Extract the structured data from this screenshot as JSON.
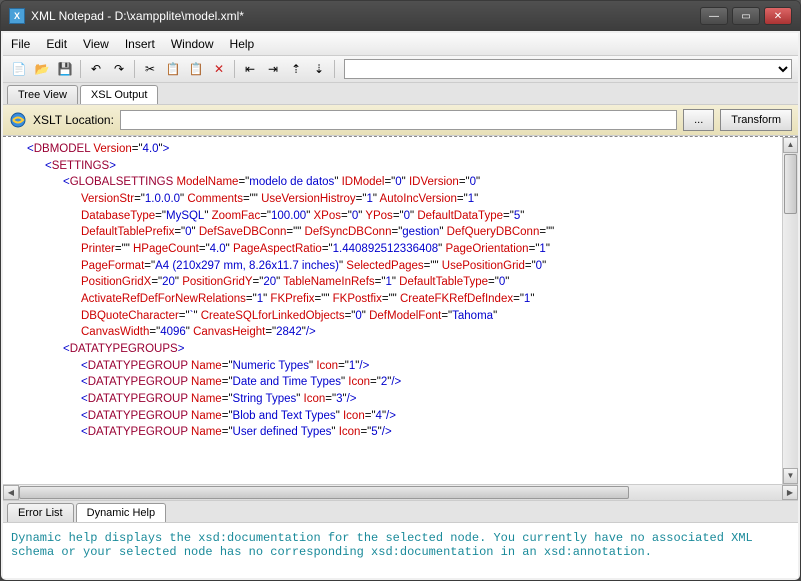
{
  "window": {
    "title": "XML Notepad - D:\\xampplite\\model.xml*"
  },
  "menu": {
    "file": "File",
    "edit": "Edit",
    "view": "View",
    "insert": "Insert",
    "window": "Window",
    "help": "Help"
  },
  "tabs": {
    "tree": "Tree View",
    "xsl": "XSL Output"
  },
  "xslt": {
    "label": "XSLT Location:",
    "browse": "...",
    "transform": "Transform"
  },
  "bottom_tabs": {
    "error": "Error List",
    "help": "Dynamic Help"
  },
  "help_text": "Dynamic help displays the xsd:documentation for the selected node. You currently have no associated XML schema or your selected node has no corresponding xsd:documentation in an xsd:annotation.",
  "xml": {
    "root": "DBMODEL",
    "root_attrs": [
      [
        "Version",
        "4.0"
      ]
    ],
    "settings": "SETTINGS",
    "global": "GLOBALSETTINGS",
    "global_attrs_lines": [
      [
        [
          "ModelName",
          "modelo de datos"
        ],
        [
          "IDModel",
          "0"
        ],
        [
          "IDVersion",
          "0"
        ]
      ],
      [
        [
          "VersionStr",
          "1.0.0.0"
        ],
        [
          "Comments",
          ""
        ],
        [
          "UseVersionHistroy",
          "1"
        ],
        [
          "AutoIncVersion",
          "1"
        ]
      ],
      [
        [
          "DatabaseType",
          "MySQL"
        ],
        [
          "ZoomFac",
          "100.00"
        ],
        [
          "XPos",
          "0"
        ],
        [
          "YPos",
          "0"
        ],
        [
          "DefaultDataType",
          "5"
        ]
      ],
      [
        [
          "DefaultTablePrefix",
          "0"
        ],
        [
          "DefSaveDBConn",
          ""
        ],
        [
          "DefSyncDBConn",
          "gestion"
        ],
        [
          "DefQueryDBConn",
          ""
        ]
      ],
      [
        [
          "Printer",
          ""
        ],
        [
          "HPageCount",
          "4.0"
        ],
        [
          "PageAspectRatio",
          "1.440892512336408"
        ],
        [
          "PageOrientation",
          "1"
        ]
      ],
      [
        [
          "PageFormat",
          "A4 (210x297 mm, 8.26x11.7 inches)"
        ],
        [
          "SelectedPages",
          ""
        ],
        [
          "UsePositionGrid",
          "0"
        ]
      ],
      [
        [
          "PositionGridX",
          "20"
        ],
        [
          "PositionGridY",
          "20"
        ],
        [
          "TableNameInRefs",
          "1"
        ],
        [
          "DefaultTableType",
          "0"
        ]
      ],
      [
        [
          "ActivateRefDefForNewRelations",
          "1"
        ],
        [
          "FKPrefix",
          ""
        ],
        [
          "FKPostfix",
          ""
        ],
        [
          "CreateFKRefDefIndex",
          "1"
        ]
      ],
      [
        [
          "DBQuoteCharacter",
          "`"
        ],
        [
          "CreateSQLforLinkedObjects",
          "0"
        ],
        [
          "DefModelFont",
          "Tahoma"
        ]
      ],
      [
        [
          "CanvasWidth",
          "4096"
        ],
        [
          "CanvasHeight",
          "2842"
        ]
      ]
    ],
    "dtg": "DATATYPEGROUPS",
    "dtgroup": "DATATYPEGROUP",
    "groups": [
      [
        [
          "Name",
          "Numeric Types"
        ],
        [
          "Icon",
          "1"
        ]
      ],
      [
        [
          "Name",
          "Date and Time Types"
        ],
        [
          "Icon",
          "2"
        ]
      ],
      [
        [
          "Name",
          "String Types"
        ],
        [
          "Icon",
          "3"
        ]
      ],
      [
        [
          "Name",
          "Blob and Text Types"
        ],
        [
          "Icon",
          "4"
        ]
      ],
      [
        [
          "Name",
          "User defined Types"
        ],
        [
          "Icon",
          "5"
        ]
      ]
    ]
  }
}
